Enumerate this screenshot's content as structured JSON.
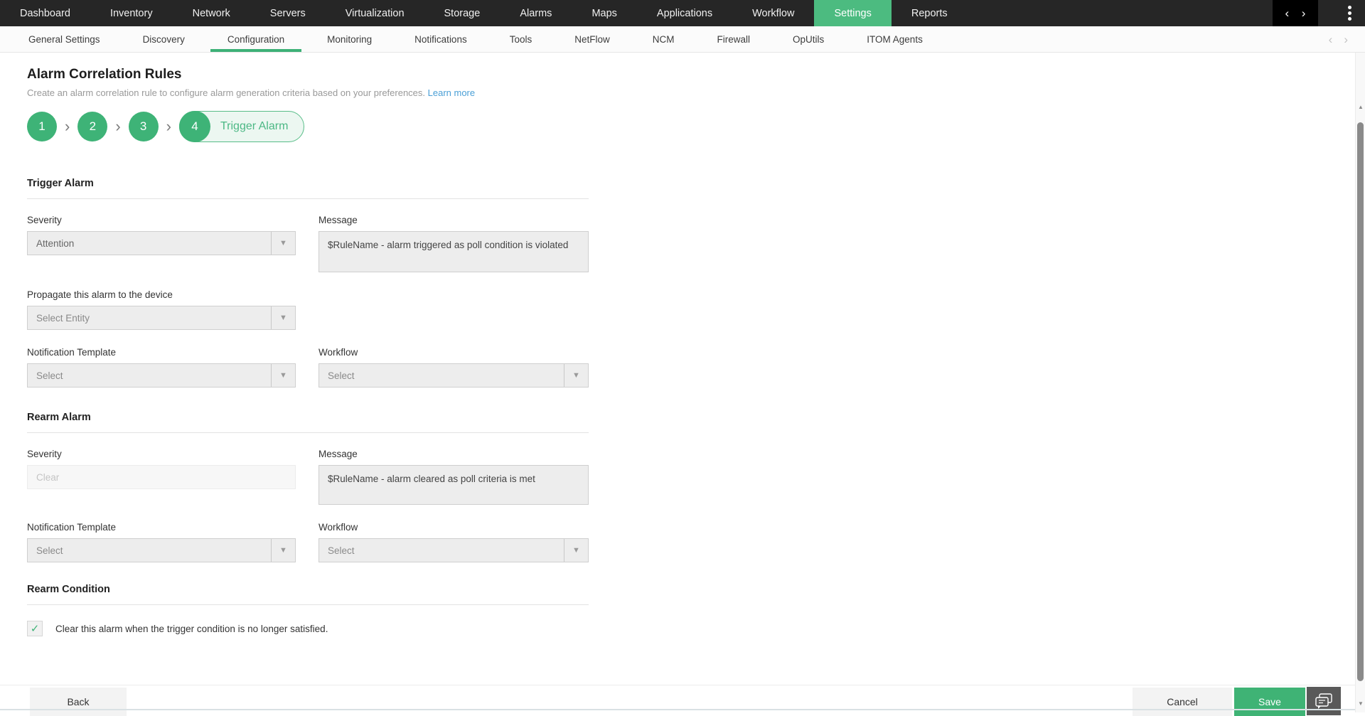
{
  "topnav": {
    "items": [
      {
        "label": "Dashboard"
      },
      {
        "label": "Inventory"
      },
      {
        "label": "Network"
      },
      {
        "label": "Servers"
      },
      {
        "label": "Virtualization"
      },
      {
        "label": "Storage"
      },
      {
        "label": "Alarms"
      },
      {
        "label": "Maps"
      },
      {
        "label": "Applications"
      },
      {
        "label": "Workflow"
      },
      {
        "label": "Settings",
        "active": true
      },
      {
        "label": "Reports"
      }
    ]
  },
  "subnav": {
    "tabs": [
      {
        "label": "General Settings"
      },
      {
        "label": "Discovery"
      },
      {
        "label": "Configuration",
        "active": true
      },
      {
        "label": "Monitoring"
      },
      {
        "label": "Notifications"
      },
      {
        "label": "Tools"
      },
      {
        "label": "NetFlow"
      },
      {
        "label": "NCM"
      },
      {
        "label": "Firewall"
      },
      {
        "label": "OpUtils"
      },
      {
        "label": "ITOM Agents"
      }
    ]
  },
  "page": {
    "title": "Alarm Correlation Rules",
    "subtitle": "Create an alarm correlation rule to configure alarm generation criteria based on your preferences.",
    "learn_more": "Learn more"
  },
  "steps": {
    "items": [
      "1",
      "2",
      "3",
      "4"
    ],
    "active_label": "Trigger Alarm"
  },
  "trigger_alarm": {
    "heading": "Trigger Alarm",
    "severity_label": "Severity",
    "severity_value": "Attention",
    "message_label": "Message",
    "message_value": "$RuleName - alarm triggered as poll condition is violated",
    "propagate_label": "Propagate this alarm to the device",
    "propagate_value": "Select Entity",
    "notification_label": "Notification Template",
    "notification_value": "Select",
    "workflow_label": "Workflow",
    "workflow_value": "Select"
  },
  "rearm_alarm": {
    "heading": "Rearm Alarm",
    "severity_label": "Severity",
    "severity_value": "Clear",
    "message_label": "Message",
    "message_value": "$RuleName - alarm cleared as poll criteria is met",
    "notification_label": "Notification Template",
    "notification_value": "Select",
    "workflow_label": "Workflow",
    "workflow_value": "Select"
  },
  "rearm_condition": {
    "heading": "Rearm Condition",
    "checkbox_label": "Clear this alarm when the trigger condition is no longer satisfied.",
    "checked": true
  },
  "footer": {
    "back": "Back",
    "cancel": "Cancel",
    "save": "Save"
  },
  "icons": {
    "check": "✓",
    "dropdown": "▼",
    "chevron_left": "‹",
    "chevron_right": "›",
    "step_separator": "›",
    "scroll_up": "▲",
    "scroll_down": "▼"
  },
  "colors": {
    "accent_green": "#3eb377",
    "active_tab_green": "#4cbb80",
    "topnav_bg": "#262626",
    "link_blue": "#4a9fd6",
    "field_bg": "#ededed"
  }
}
